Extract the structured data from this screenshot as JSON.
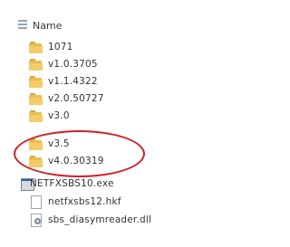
{
  "header": {
    "name_label": "Name"
  },
  "items": [
    {
      "name": "1071",
      "type": "folder"
    },
    {
      "name": "v1.0.3705",
      "type": "folder"
    },
    {
      "name": "v1.1.4322",
      "type": "folder"
    },
    {
      "name": "v2.0.50727",
      "type": "folder"
    },
    {
      "name": "v3.0",
      "type": "folder"
    },
    {
      "name": "v3.5",
      "type": "folder"
    },
    {
      "name": "v4.0.30319",
      "type": "folder"
    },
    {
      "name": "NETFXSBS10.exe",
      "type": "exe"
    },
    {
      "name": "netfxsbs12.hkf",
      "type": "file"
    },
    {
      "name": "sbs_diasymreader.dll",
      "type": "dll"
    }
  ],
  "highlight": {
    "color": "#d11e27",
    "items": [
      "v3.5",
      "v4.0.30319"
    ]
  }
}
